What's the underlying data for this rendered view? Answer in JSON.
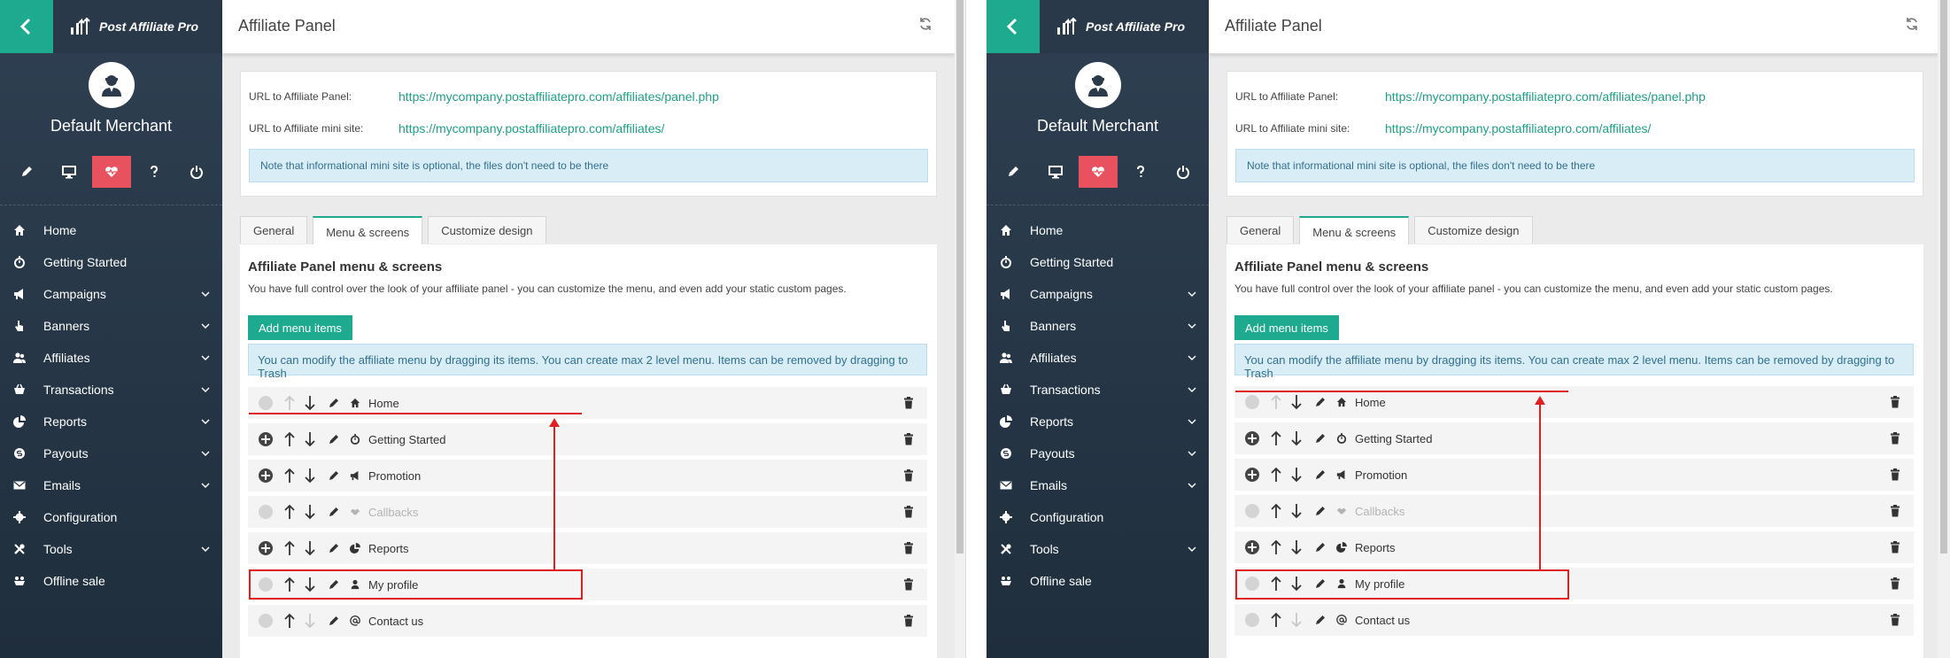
{
  "app": {
    "brand": "Post Affiliate Pro",
    "merchant": "Default Merchant",
    "page_title": "Affiliate Panel",
    "colors": {
      "accent": "#1eaa8f",
      "sidebar": "#2b3b4c",
      "active_quick": "#e8525e",
      "annotation": "#e02020",
      "link": "#1ea085"
    }
  },
  "quick_icons": [
    "pencil-icon",
    "monitor-icon",
    "heart-pulse-icon",
    "question-icon",
    "power-icon"
  ],
  "nav": [
    {
      "label": "Home",
      "icon": "home-icon",
      "has_children": false
    },
    {
      "label": "Getting Started",
      "icon": "stopwatch-icon",
      "has_children": false
    },
    {
      "label": "Campaigns",
      "icon": "megaphone-icon",
      "has_children": true
    },
    {
      "label": "Banners",
      "icon": "hand-pointer-icon",
      "has_children": true
    },
    {
      "label": "Affiliates",
      "icon": "users-icon",
      "has_children": true
    },
    {
      "label": "Transactions",
      "icon": "basket-icon",
      "has_children": true
    },
    {
      "label": "Reports",
      "icon": "pie-chart-icon",
      "has_children": true
    },
    {
      "label": "Payouts",
      "icon": "money-icon",
      "has_children": true
    },
    {
      "label": "Emails",
      "icon": "envelope-icon",
      "has_children": true
    },
    {
      "label": "Configuration",
      "icon": "gear-icon",
      "has_children": false
    },
    {
      "label": "Tools",
      "icon": "tools-icon",
      "has_children": true
    },
    {
      "label": "Offline sale",
      "icon": "offline-sale-icon",
      "has_children": false
    }
  ],
  "urls": {
    "panel_label": "URL to Affiliate Panel:",
    "panel_url": "https://mycompany.postaffiliatepro.com/affiliates/panel.php",
    "mini_label": "URL to Affiliate mini site:",
    "mini_url": "https://mycompany.postaffiliatepro.com/affiliates/",
    "note": "Note that informational mini site is optional, the files don't need to be there"
  },
  "tabs": [
    {
      "label": "General",
      "active": false
    },
    {
      "label": "Menu & screens",
      "active": true
    },
    {
      "label": "Customize design",
      "active": false
    }
  ],
  "menu": {
    "title": "Affiliate Panel menu & screens",
    "description": "You have full control over the look of your affiliate panel - you can customize the menu, and even add your static custom pages.",
    "add_button": "Add menu items",
    "info": "You can modify the affiliate menu by dragging its items. You can create max 2 level menu. Items can be removed by dragging to Trash",
    "items": [
      {
        "label": "Home",
        "icon": "home-icon",
        "expandable": false,
        "up_enabled": false,
        "down_enabled": true,
        "muted": false
      },
      {
        "label": "Getting Started",
        "icon": "stopwatch-icon",
        "expandable": true,
        "up_enabled": true,
        "down_enabled": true,
        "muted": false
      },
      {
        "label": "Promotion",
        "icon": "megaphone-icon",
        "expandable": true,
        "up_enabled": true,
        "down_enabled": true,
        "muted": false
      },
      {
        "label": "Callbacks",
        "icon": "handshake-icon",
        "expandable": false,
        "up_enabled": true,
        "down_enabled": true,
        "muted": true
      },
      {
        "label": "Reports",
        "icon": "pie-chart-icon",
        "expandable": true,
        "up_enabled": true,
        "down_enabled": true,
        "muted": false
      },
      {
        "label": "My profile",
        "icon": "user-icon",
        "expandable": false,
        "up_enabled": true,
        "down_enabled": true,
        "muted": false
      },
      {
        "label": "Contact us",
        "icon": "at-icon",
        "expandable": false,
        "up_enabled": true,
        "down_enabled": false,
        "muted": false
      }
    ]
  }
}
